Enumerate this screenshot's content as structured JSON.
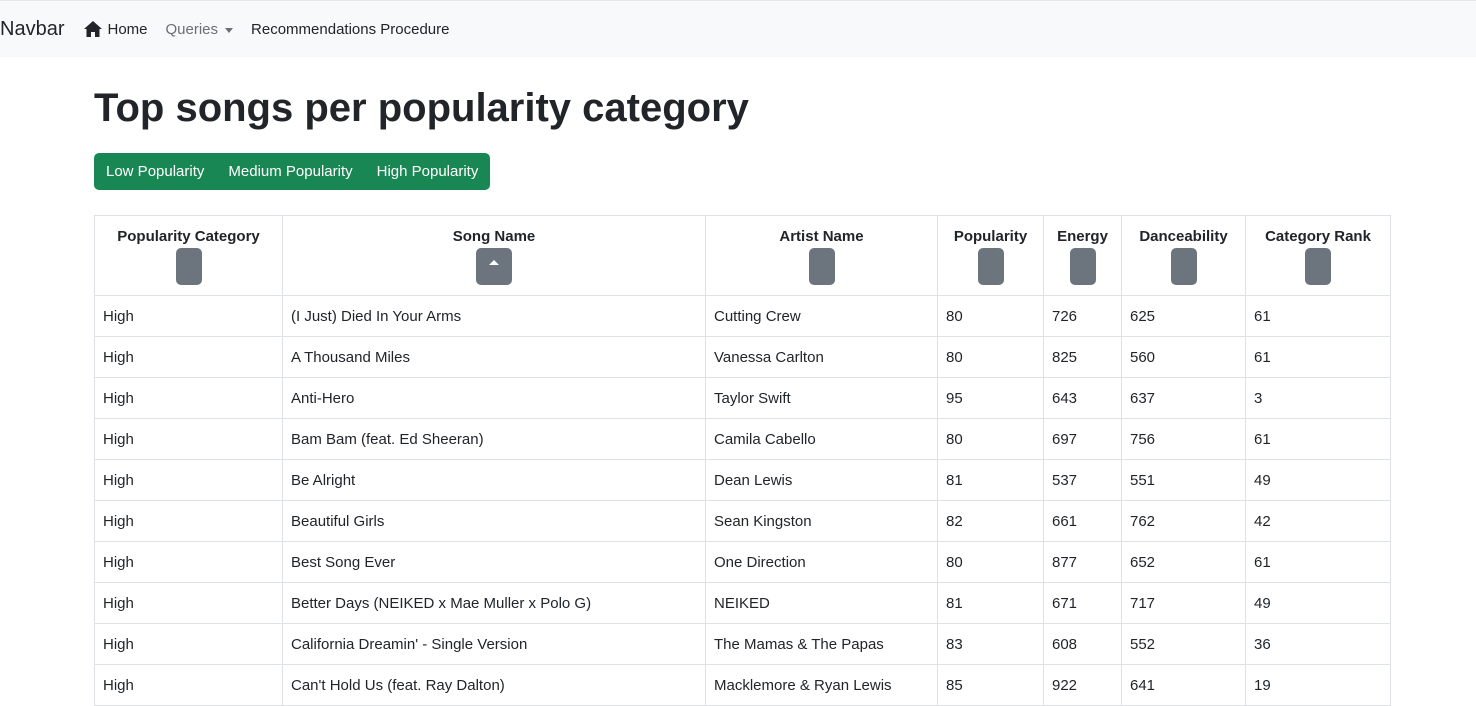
{
  "navbar": {
    "brand": "Navbar",
    "home_label": "Home",
    "queries_label": "Queries",
    "recommendations_label": "Recommendations Procedure"
  },
  "page": {
    "title": "Top songs per popularity category"
  },
  "filters": {
    "low": "Low Popularity",
    "medium": "Medium Popularity",
    "high": "High Popularity",
    "button_color": "#198754"
  },
  "table": {
    "headers": [
      "Popularity Category",
      "Song Name",
      "Artist Name",
      "Popularity",
      "Energy",
      "Danceability",
      "Category Rank"
    ],
    "sorted_column": "Song Name",
    "rows": [
      [
        "High",
        "(I Just) Died In Your Arms",
        "Cutting Crew",
        "80",
        "726",
        "625",
        "61"
      ],
      [
        "High",
        "A Thousand Miles",
        "Vanessa Carlton",
        "80",
        "825",
        "560",
        "61"
      ],
      [
        "High",
        "Anti-Hero",
        "Taylor Swift",
        "95",
        "643",
        "637",
        "3"
      ],
      [
        "High",
        "Bam Bam (feat. Ed Sheeran)",
        "Camila Cabello",
        "80",
        "697",
        "756",
        "61"
      ],
      [
        "High",
        "Be Alright",
        "Dean Lewis",
        "81",
        "537",
        "551",
        "49"
      ],
      [
        "High",
        "Beautiful Girls",
        "Sean Kingston",
        "82",
        "661",
        "762",
        "42"
      ],
      [
        "High",
        "Best Song Ever",
        "One Direction",
        "80",
        "877",
        "652",
        "61"
      ],
      [
        "High",
        "Better Days (NEIKED x Mae Muller x Polo G)",
        "NEIKED",
        "81",
        "671",
        "717",
        "49"
      ],
      [
        "High",
        "California Dreamin' - Single Version",
        "The Mamas & The Papas",
        "83",
        "608",
        "552",
        "36"
      ],
      [
        "High",
        "Can't Hold Us (feat. Ray Dalton)",
        "Macklemore & Ryan Lewis",
        "85",
        "922",
        "641",
        "19"
      ]
    ]
  }
}
